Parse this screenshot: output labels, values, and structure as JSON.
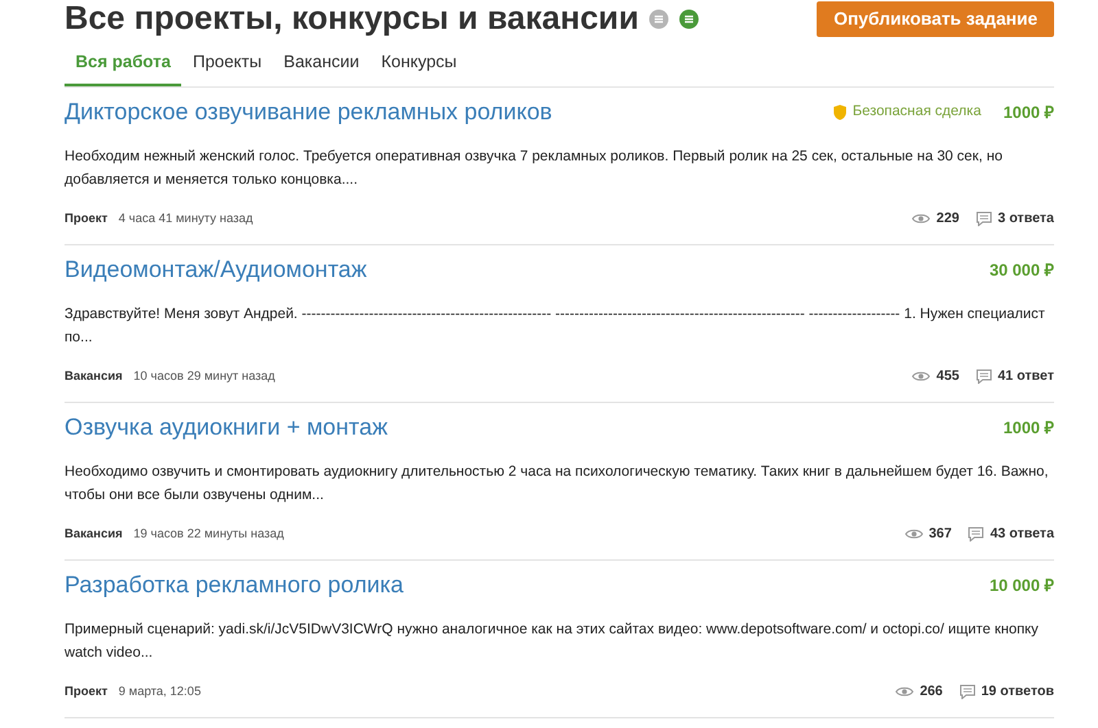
{
  "header": {
    "title": "Все проекты, конкурсы и вакансии",
    "publish_button": "Опубликовать задание"
  },
  "tabs": [
    {
      "label": "Вся работа",
      "selected": true
    },
    {
      "label": "Проекты",
      "selected": false
    },
    {
      "label": "Вакансии",
      "selected": false
    },
    {
      "label": "Конкурсы",
      "selected": false
    }
  ],
  "listings": [
    {
      "title": "Дикторское озвучивание рекламных роликов",
      "safe_deal": "Безопасная сделка",
      "price": "1000 ₽",
      "description": "Необходим нежный женский голос. Требуется оперативная озвучка 7 рекламных роликов. Первый ролик на 25 сек, остальные на 30 сек, но добавляется и меняется только концовка....",
      "type": "Проект",
      "time": "4 часа 41 минуту назад",
      "views": "229",
      "replies": "3 ответа"
    },
    {
      "title": "Видеомонтаж/Аудиомонтаж",
      "price": "30 000 ₽",
      "description": "Здравствуйте! Меня зовут Андрей. ---------------------------------------------------- ---------------------------------------------------- ------------------- 1. Нужен специалист по...",
      "type": "Вакансия",
      "time": "10 часов 29 минут назад",
      "views": "455",
      "replies": "41 ответ"
    },
    {
      "title": "Озвучка аудиокниги + монтаж",
      "price": "1000 ₽",
      "description": "Необходимо озвучить и смонтировать аудиокнигу длительностью 2 часа на психологическую тематику. Таких книг в дальнейшем будет 16. Важно, чтобы они все были озвучены одним...",
      "type": "Вакансия",
      "time": "19 часов 22 минуты назад",
      "views": "367",
      "replies": "43 ответа"
    },
    {
      "title": "Разработка рекламного ролика",
      "price": "10 000 ₽",
      "description": "Примерный сценарий: yadi.sk/i/JcV5IDwV3ICWrQ нужно аналогичное как на этих сайтах видео: www.depotsoftware.com/ и  octopi.co/  ищите кнопку watch video...",
      "type": "Проект",
      "time": "9 марта, 12:05",
      "views": "266",
      "replies": "19 ответов"
    }
  ]
}
